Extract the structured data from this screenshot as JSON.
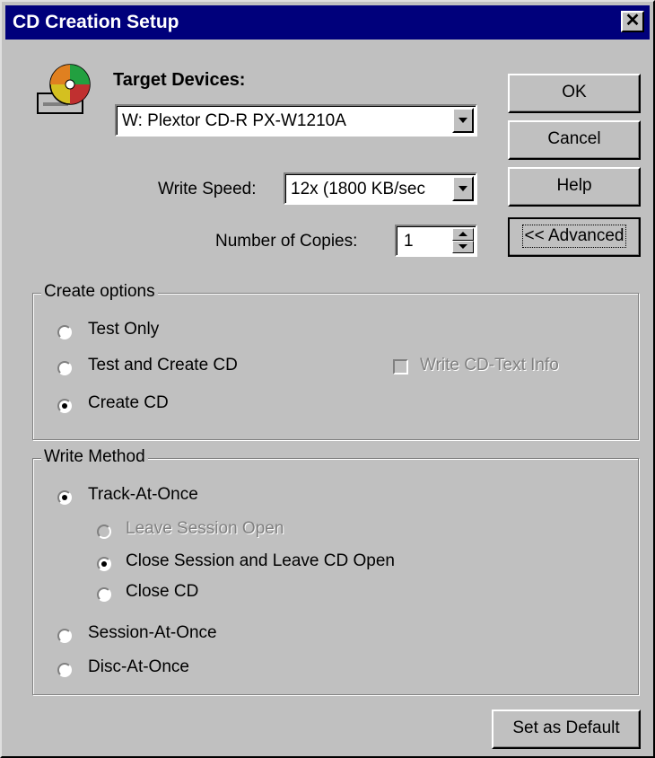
{
  "window": {
    "title": "CD Creation Setup",
    "close_label": "✕"
  },
  "target_devices": {
    "label": "Target Devices:",
    "selected": "W: Plextor CD-R PX-W1210A"
  },
  "write_speed": {
    "label": "Write Speed:",
    "selected": "12x (1800 KB/sec"
  },
  "copies": {
    "label": "Number of Copies:",
    "value": "1"
  },
  "buttons": {
    "ok": "OK",
    "cancel": "Cancel",
    "help": "Help",
    "advanced": "<< Advanced",
    "set_default": "Set as Default"
  },
  "create_options": {
    "legend": "Create options",
    "test_only": "Test Only",
    "test_and_create": "Test and Create CD",
    "create_cd": "Create CD",
    "selected": "create_cd",
    "write_cd_text": "Write CD-Text Info"
  },
  "write_method": {
    "legend": "Write Method",
    "track_at_once": "Track-At-Once",
    "leave_session_open": "Leave Session Open",
    "close_session_leave_cd_open": "Close Session and Leave CD Open",
    "close_cd": "Close CD",
    "session_at_once": "Session-At-Once",
    "disc_at_once": "Disc-At-Once",
    "selected": "track_at_once",
    "sub_selected": "close_session_leave_cd_open"
  },
  "colors": {
    "titlebar": "#00007b",
    "face": "#c0c0c0"
  }
}
